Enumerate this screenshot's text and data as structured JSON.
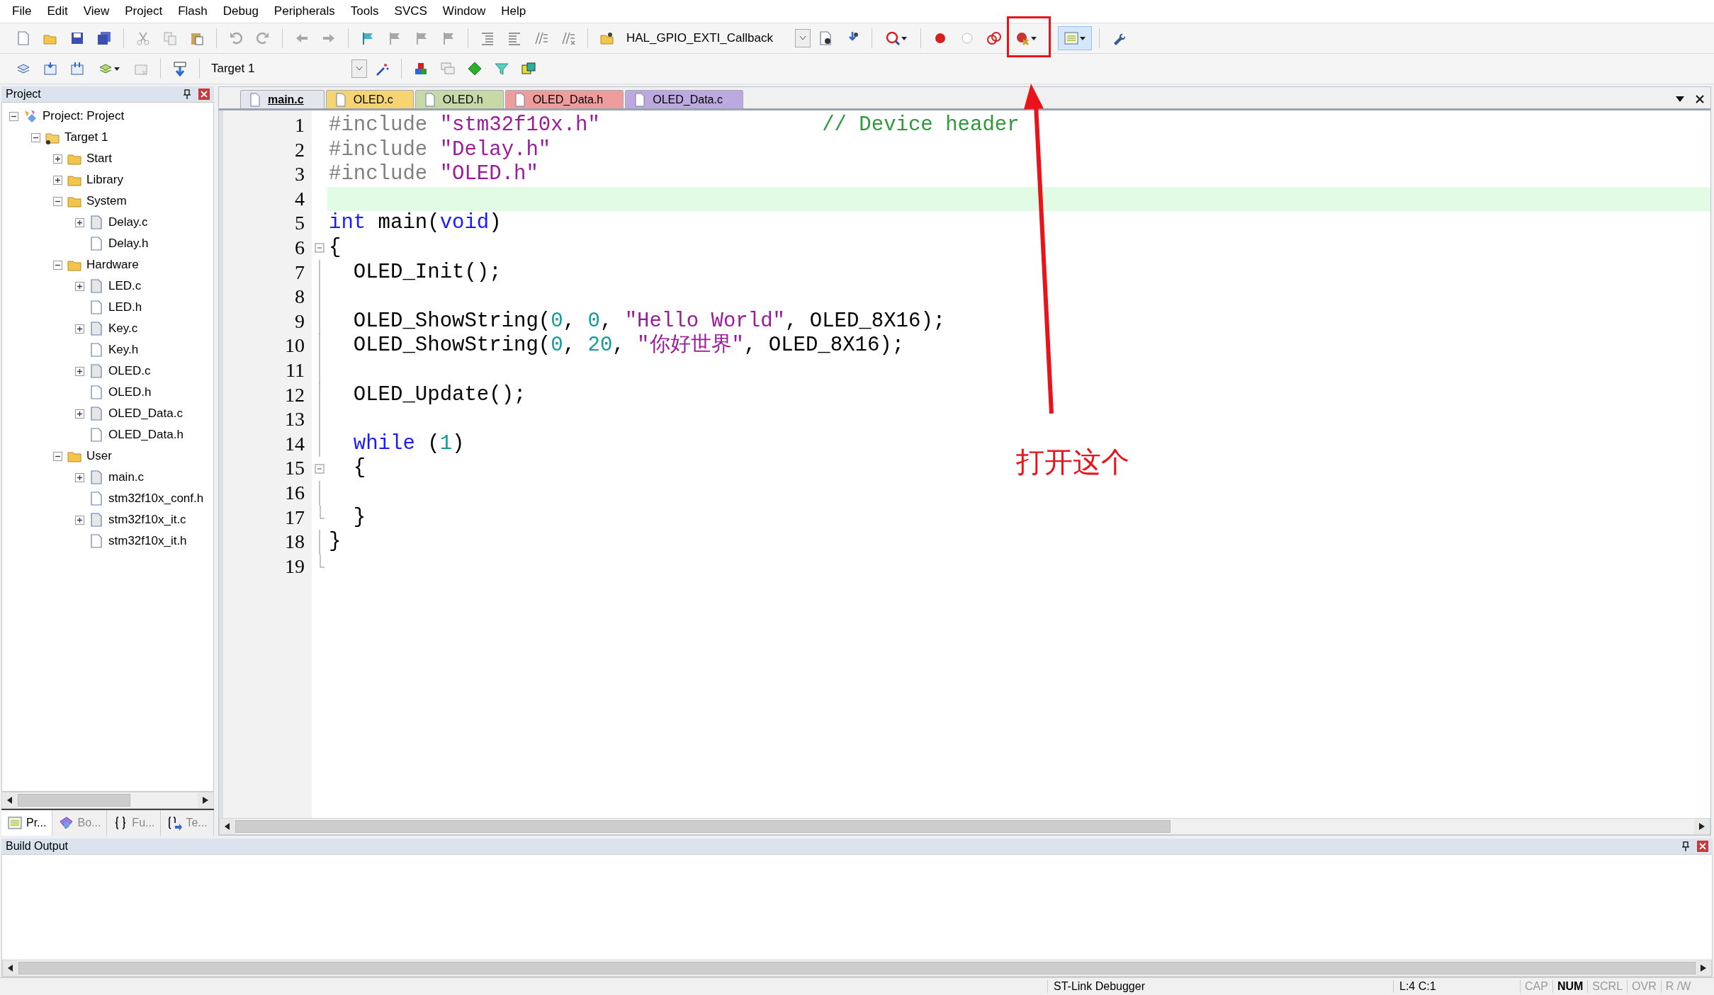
{
  "menu": [
    "File",
    "Edit",
    "View",
    "Project",
    "Flash",
    "Debug",
    "Peripherals",
    "Tools",
    "SVCS",
    "Window",
    "Help"
  ],
  "toolbar": {
    "function_combo": "HAL_GPIO_EXTI_Callback",
    "target_combo": "Target 1"
  },
  "project_panel": {
    "title": "Project",
    "tree": [
      {
        "label": "Project: Project",
        "kind": "project",
        "expanded": true,
        "children": [
          {
            "label": "Target 1",
            "kind": "target",
            "expanded": true,
            "children": [
              {
                "label": "Start",
                "kind": "folder",
                "expanded": false
              },
              {
                "label": "Library",
                "kind": "folder",
                "expanded": false
              },
              {
                "label": "System",
                "kind": "folder",
                "expanded": true,
                "children": [
                  {
                    "label": "Delay.c",
                    "kind": "source",
                    "expanded": false
                  },
                  {
                    "label": "Delay.h",
                    "kind": "header"
                  }
                ]
              },
              {
                "label": "Hardware",
                "kind": "folder",
                "expanded": true,
                "children": [
                  {
                    "label": "LED.c",
                    "kind": "source",
                    "expanded": false
                  },
                  {
                    "label": "LED.h",
                    "kind": "header"
                  },
                  {
                    "label": "Key.c",
                    "kind": "source",
                    "expanded": false
                  },
                  {
                    "label": "Key.h",
                    "kind": "header"
                  },
                  {
                    "label": "OLED.c",
                    "kind": "source",
                    "expanded": false
                  },
                  {
                    "label": "OLED.h",
                    "kind": "header"
                  },
                  {
                    "label": "OLED_Data.c",
                    "kind": "source",
                    "expanded": false
                  },
                  {
                    "label": "OLED_Data.h",
                    "kind": "header"
                  }
                ]
              },
              {
                "label": "User",
                "kind": "folder",
                "expanded": true,
                "children": [
                  {
                    "label": "main.c",
                    "kind": "source",
                    "expanded": false
                  },
                  {
                    "label": "stm32f10x_conf.h",
                    "kind": "header"
                  },
                  {
                    "label": "stm32f10x_it.c",
                    "kind": "source",
                    "expanded": false
                  },
                  {
                    "label": "stm32f10x_it.h",
                    "kind": "header"
                  }
                ]
              }
            ]
          }
        ]
      }
    ],
    "tabs": [
      {
        "label": "Pr...",
        "kind": "project",
        "selected": true
      },
      {
        "label": "Bo...",
        "kind": "books",
        "selected": false
      },
      {
        "label": "Fu...",
        "kind": "functions",
        "selected": false
      },
      {
        "label": "Te...",
        "kind": "templates",
        "selected": false
      }
    ]
  },
  "editor": {
    "tabs": [
      {
        "label": "main.c",
        "selected": true,
        "color": "#e4e6ee"
      },
      {
        "label": "OLED.c",
        "selected": false,
        "color": "#f6d472"
      },
      {
        "label": "OLED.h",
        "selected": false,
        "color": "#c6d9a6"
      },
      {
        "label": "OLED_Data.h",
        "selected": false,
        "color": "#ee9c9c"
      },
      {
        "label": "OLED_Data.c",
        "selected": false,
        "color": "#bca9e0"
      }
    ],
    "lines": [
      {
        "number": "1",
        "current": false,
        "fold_start": false,
        "fold_end": false,
        "tokens": [
          {
            "kind": "preproc",
            "text": "#include "
          },
          {
            "kind": "string",
            "text": "\"stm32f10x.h\""
          },
          {
            "kind": "comment",
            "text": "// Device header"
          }
        ]
      },
      {
        "number": "2",
        "current": false,
        "fold_start": false,
        "fold_end": false,
        "tokens": [
          {
            "kind": "preproc",
            "text": "#include "
          },
          {
            "kind": "string",
            "text": "\"Delay.h\""
          }
        ]
      },
      {
        "number": "3",
        "current": false,
        "fold_start": false,
        "fold_end": false,
        "tokens": [
          {
            "kind": "preproc",
            "text": "#include "
          },
          {
            "kind": "string",
            "text": "\"OLED.h\""
          }
        ]
      },
      {
        "number": "4",
        "current": true,
        "fold_start": false,
        "fold_end": false
      },
      {
        "number": "5",
        "current": false,
        "fold_start": false,
        "fold_end": false,
        "tokens": [
          {
            "kind": "keyword",
            "text": "int"
          },
          {
            "kind": "plain",
            "text": " main("
          },
          {
            "kind": "keyword",
            "text": "void"
          },
          {
            "kind": "plain",
            "text": ")"
          }
        ]
      },
      {
        "number": "6",
        "current": false,
        "fold_start": true,
        "fold_end": false,
        "tokens": [
          {
            "kind": "plain",
            "text": "{"
          }
        ]
      },
      {
        "number": "7",
        "current": false,
        "fold_start": false,
        "fold_end": false,
        "tokens": [
          {
            "kind": "plain",
            "text": "  OLED_Init();"
          }
        ]
      },
      {
        "number": "8",
        "current": false,
        "fold_start": false,
        "fold_end": false
      },
      {
        "number": "9",
        "current": false,
        "fold_start": false,
        "fold_end": false,
        "tokens": [
          {
            "kind": "plain",
            "text": "  OLED_ShowString("
          },
          {
            "kind": "number",
            "text": "0"
          },
          {
            "kind": "plain",
            "text": ", "
          },
          {
            "kind": "number",
            "text": "0"
          },
          {
            "kind": "plain",
            "text": ", "
          },
          {
            "kind": "string",
            "text": "\"Hello World\""
          },
          {
            "kind": "plain",
            "text": ", OLED_8X16);"
          }
        ]
      },
      {
        "number": "10",
        "current": false,
        "fold_start": false,
        "fold_end": false,
        "tokens": [
          {
            "kind": "plain",
            "text": "  OLED_ShowString("
          },
          {
            "kind": "number",
            "text": "0"
          },
          {
            "kind": "plain",
            "text": ", "
          },
          {
            "kind": "number",
            "text": "20"
          },
          {
            "kind": "plain",
            "text": ", "
          },
          {
            "kind": "string",
            "text": "\"你好世界\""
          },
          {
            "kind": "plain",
            "text": ", OLED_8X16);"
          }
        ]
      },
      {
        "number": "11",
        "current": false,
        "fold_start": false,
        "fold_end": false
      },
      {
        "number": "12",
        "current": false,
        "fold_start": false,
        "fold_end": false,
        "tokens": [
          {
            "kind": "plain",
            "text": "  OLED_Update();"
          }
        ]
      },
      {
        "number": "13",
        "current": false,
        "fold_start": false,
        "fold_end": false
      },
      {
        "number": "14",
        "current": false,
        "fold_start": false,
        "fold_end": false,
        "tokens": [
          {
            "kind": "keyword",
            "text": "  while"
          },
          {
            "kind": "plain",
            "text": " ("
          },
          {
            "kind": "number",
            "text": "1"
          },
          {
            "kind": "plain",
            "text": ")"
          }
        ]
      },
      {
        "number": "15",
        "current": false,
        "fold_start": true,
        "fold_end": false,
        "tokens": [
          {
            "kind": "plain",
            "text": "  {"
          }
        ]
      },
      {
        "number": "16",
        "current": false,
        "fold_start": false,
        "fold_end": false
      },
      {
        "number": "17",
        "current": false,
        "fold_start": false,
        "fold_end": true,
        "tokens": [
          {
            "kind": "plain",
            "text": "  }"
          }
        ]
      },
      {
        "number": "18",
        "current": false,
        "fold_start": false,
        "fold_end": false,
        "tokens": [
          {
            "kind": "plain",
            "text": "}"
          }
        ]
      },
      {
        "number": "19",
        "current": false,
        "fold_start": false,
        "fold_end": true
      }
    ]
  },
  "annotation": {
    "text": "打开这个"
  },
  "build_output": {
    "title": "Build Output"
  },
  "status_bar": {
    "debugger": "ST-Link Debugger",
    "position": "L:4 C:1",
    "indicators": [
      {
        "label": "CAP",
        "on": false
      },
      {
        "label": "NUM",
        "on": true
      },
      {
        "label": "SCRL",
        "on": false
      },
      {
        "label": "OVR",
        "on": false
      },
      {
        "label": "R /W",
        "on": false
      }
    ]
  }
}
